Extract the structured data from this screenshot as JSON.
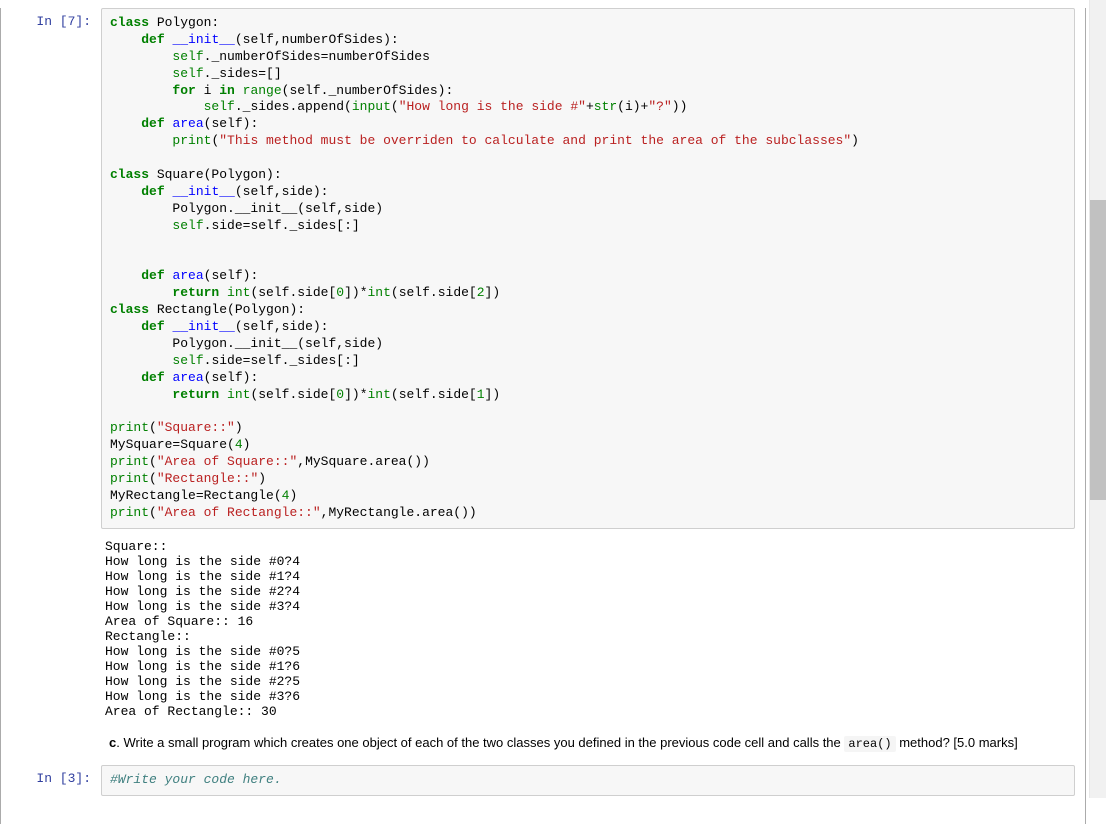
{
  "cells": {
    "cell1": {
      "prompt_label": "In [7]:",
      "prompt_num": "7"
    },
    "cell2": {
      "prompt_label": "In [3]:",
      "prompt_num": "3",
      "comment": "#Write your code here."
    }
  },
  "code": {
    "l1_class": "class",
    "l1_name": " Polygon:",
    "l2_def": "def",
    "l2_init": "__init__",
    "l2_sig": "(self,numberOfSides):",
    "l3_self": "self",
    "l3_rest": "._numberOfSides=numberOfSides",
    "l4_self": "self",
    "l4_rest": "._sides=[]",
    "l5_for": "for",
    "l5_i": " i ",
    "l5_in": "in",
    "l5_range": " range",
    "l5_rest": "(self._numberOfSides):",
    "l6_self": "self",
    "l6_app": "._sides.append(",
    "l6_input": "input",
    "l6_paren": "(",
    "l6_str1": "\"How long is the side #\"",
    "l6_plus": "+",
    "l6_strf": "str",
    "l6_ipar": "(i)+",
    "l6_str2": "\"?\"",
    "l6_end": "))",
    "l7_def": "def",
    "l7_area": "area",
    "l7_sig": "(self):",
    "l8_print": "print",
    "l8_str": "\"This method must be overriden to calculate and print the area of the subclasses\"",
    "l10_class": "class",
    "l10_name": " Square(Polygon):",
    "l11_def": "def",
    "l11_init": "__init__",
    "l11_sig": "(self,side):",
    "l12": "Polygon.__init__(self,side)",
    "l13_self": "self",
    "l13_rest": ".side=self._sides[:]",
    "l15_def": "def",
    "l15_area": "area",
    "l15_sig": "(self):",
    "l16_return": "return",
    "l16_int": "int",
    "l16_p1": "(self.side[",
    "l16_0": "0",
    "l16_mid": "])*",
    "l16_int2": "int",
    "l16_p2": "(self.side[",
    "l16_2": "2",
    "l16_end": "])",
    "l17_class": "class",
    "l17_name": " Rectangle(Polygon):",
    "l18_def": "def",
    "l18_init": "__init__",
    "l18_sig": "(self,side):",
    "l19": "Polygon.__init__(self,side)",
    "l20_self": "self",
    "l20_rest": ".side=self._sides[:]",
    "l21_def": "def",
    "l21_area": "area",
    "l21_sig": "(self):",
    "l22_return": "return",
    "l22_int": "int",
    "l22_p1": "(self.side[",
    "l22_0": "0",
    "l22_mid": "])*",
    "l22_int2": "int",
    "l22_p2": "(self.side[",
    "l22_1": "1",
    "l22_end": "])",
    "l24_print": "print",
    "l24_str": "\"Square::\"",
    "l25": "MySquare=Square(",
    "l25_4": "4",
    "l25_end": ")",
    "l26_print": "print",
    "l26_str": "\"Area of Square::\"",
    "l26_rest": ",MySquare.area())",
    "l27_print": "print",
    "l27_str": "\"Rectangle::\"",
    "l28": "MyRectangle=Rectangle(",
    "l28_4": "4",
    "l28_end": ")",
    "l29_print": "print",
    "l29_str": "\"Area of Rectangle::\"",
    "l29_rest": ",MyRectangle.area())"
  },
  "output": {
    "l1": "Square::",
    "l2": "How long is the side #0?4",
    "l3": "How long is the side #1?4",
    "l4": "How long is the side #2?4",
    "l5": "How long is the side #3?4",
    "l6": "Area of Square:: 16",
    "l7": "Rectangle::",
    "l8": "How long is the side #0?5",
    "l9": "How long is the side #1?6",
    "l10": "How long is the side #2?5",
    "l11": "How long is the side #3?6",
    "l12": "Area of Rectangle:: 30"
  },
  "markdown": {
    "c_bold": "c",
    "text": ". Write a small program which creates one object of each of the two classes you defined in the previous code cell and calls the ",
    "code_inline": "area()",
    "text2": " method? [5.0 marks]"
  }
}
